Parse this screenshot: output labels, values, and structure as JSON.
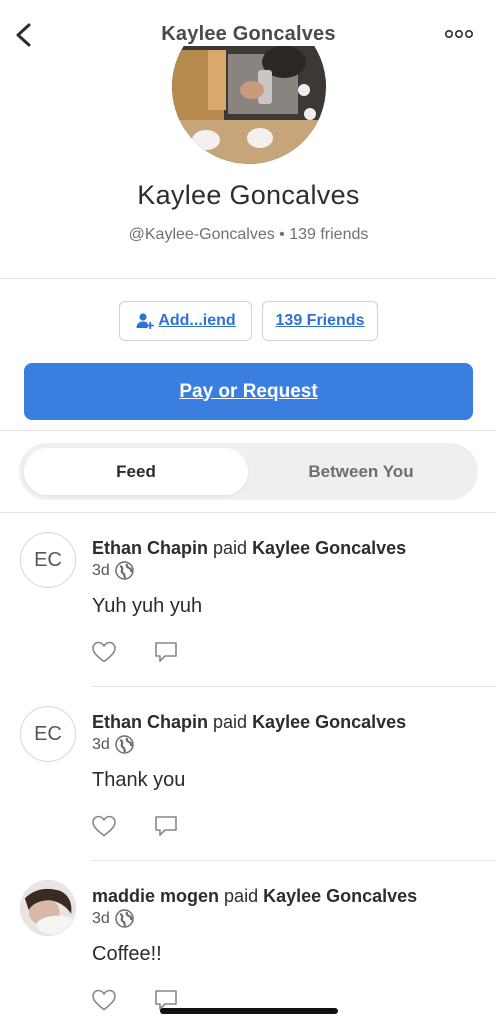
{
  "header": {
    "title": "Kaylee Goncalves"
  },
  "profile": {
    "name": "Kaylee Goncalves",
    "username": "@Kaylee-Goncalves",
    "friends_summary": "139 friends",
    "subtitle": "@Kaylee-Goncalves • 139 friends"
  },
  "actions": {
    "add_friend_label": "Add...iend",
    "friends_label": "139 Friends",
    "pay_label": "Pay or Request"
  },
  "tabs": [
    {
      "label": "Feed",
      "selected": true
    },
    {
      "label": "Between You",
      "selected": false
    }
  ],
  "feed": [
    {
      "avatar_initials": "EC",
      "actor": "Ethan Chapin",
      "verb": "paid",
      "target": "Kaylee Goncalves",
      "time": "3d",
      "note": "Yuh yuh yuh"
    },
    {
      "avatar_initials": "EC",
      "actor": "Ethan Chapin",
      "verb": "paid",
      "target": "Kaylee Goncalves",
      "time": "3d",
      "note": "Thank you"
    },
    {
      "avatar_initials": "",
      "actor": "maddie mogen",
      "verb": "paid",
      "target": "Kaylee Goncalves",
      "time": "3d",
      "note": "Coffee!!"
    }
  ],
  "colors": {
    "accent": "#3a7ee0",
    "link": "#2f72d6",
    "divider": "#e3e3e5"
  }
}
